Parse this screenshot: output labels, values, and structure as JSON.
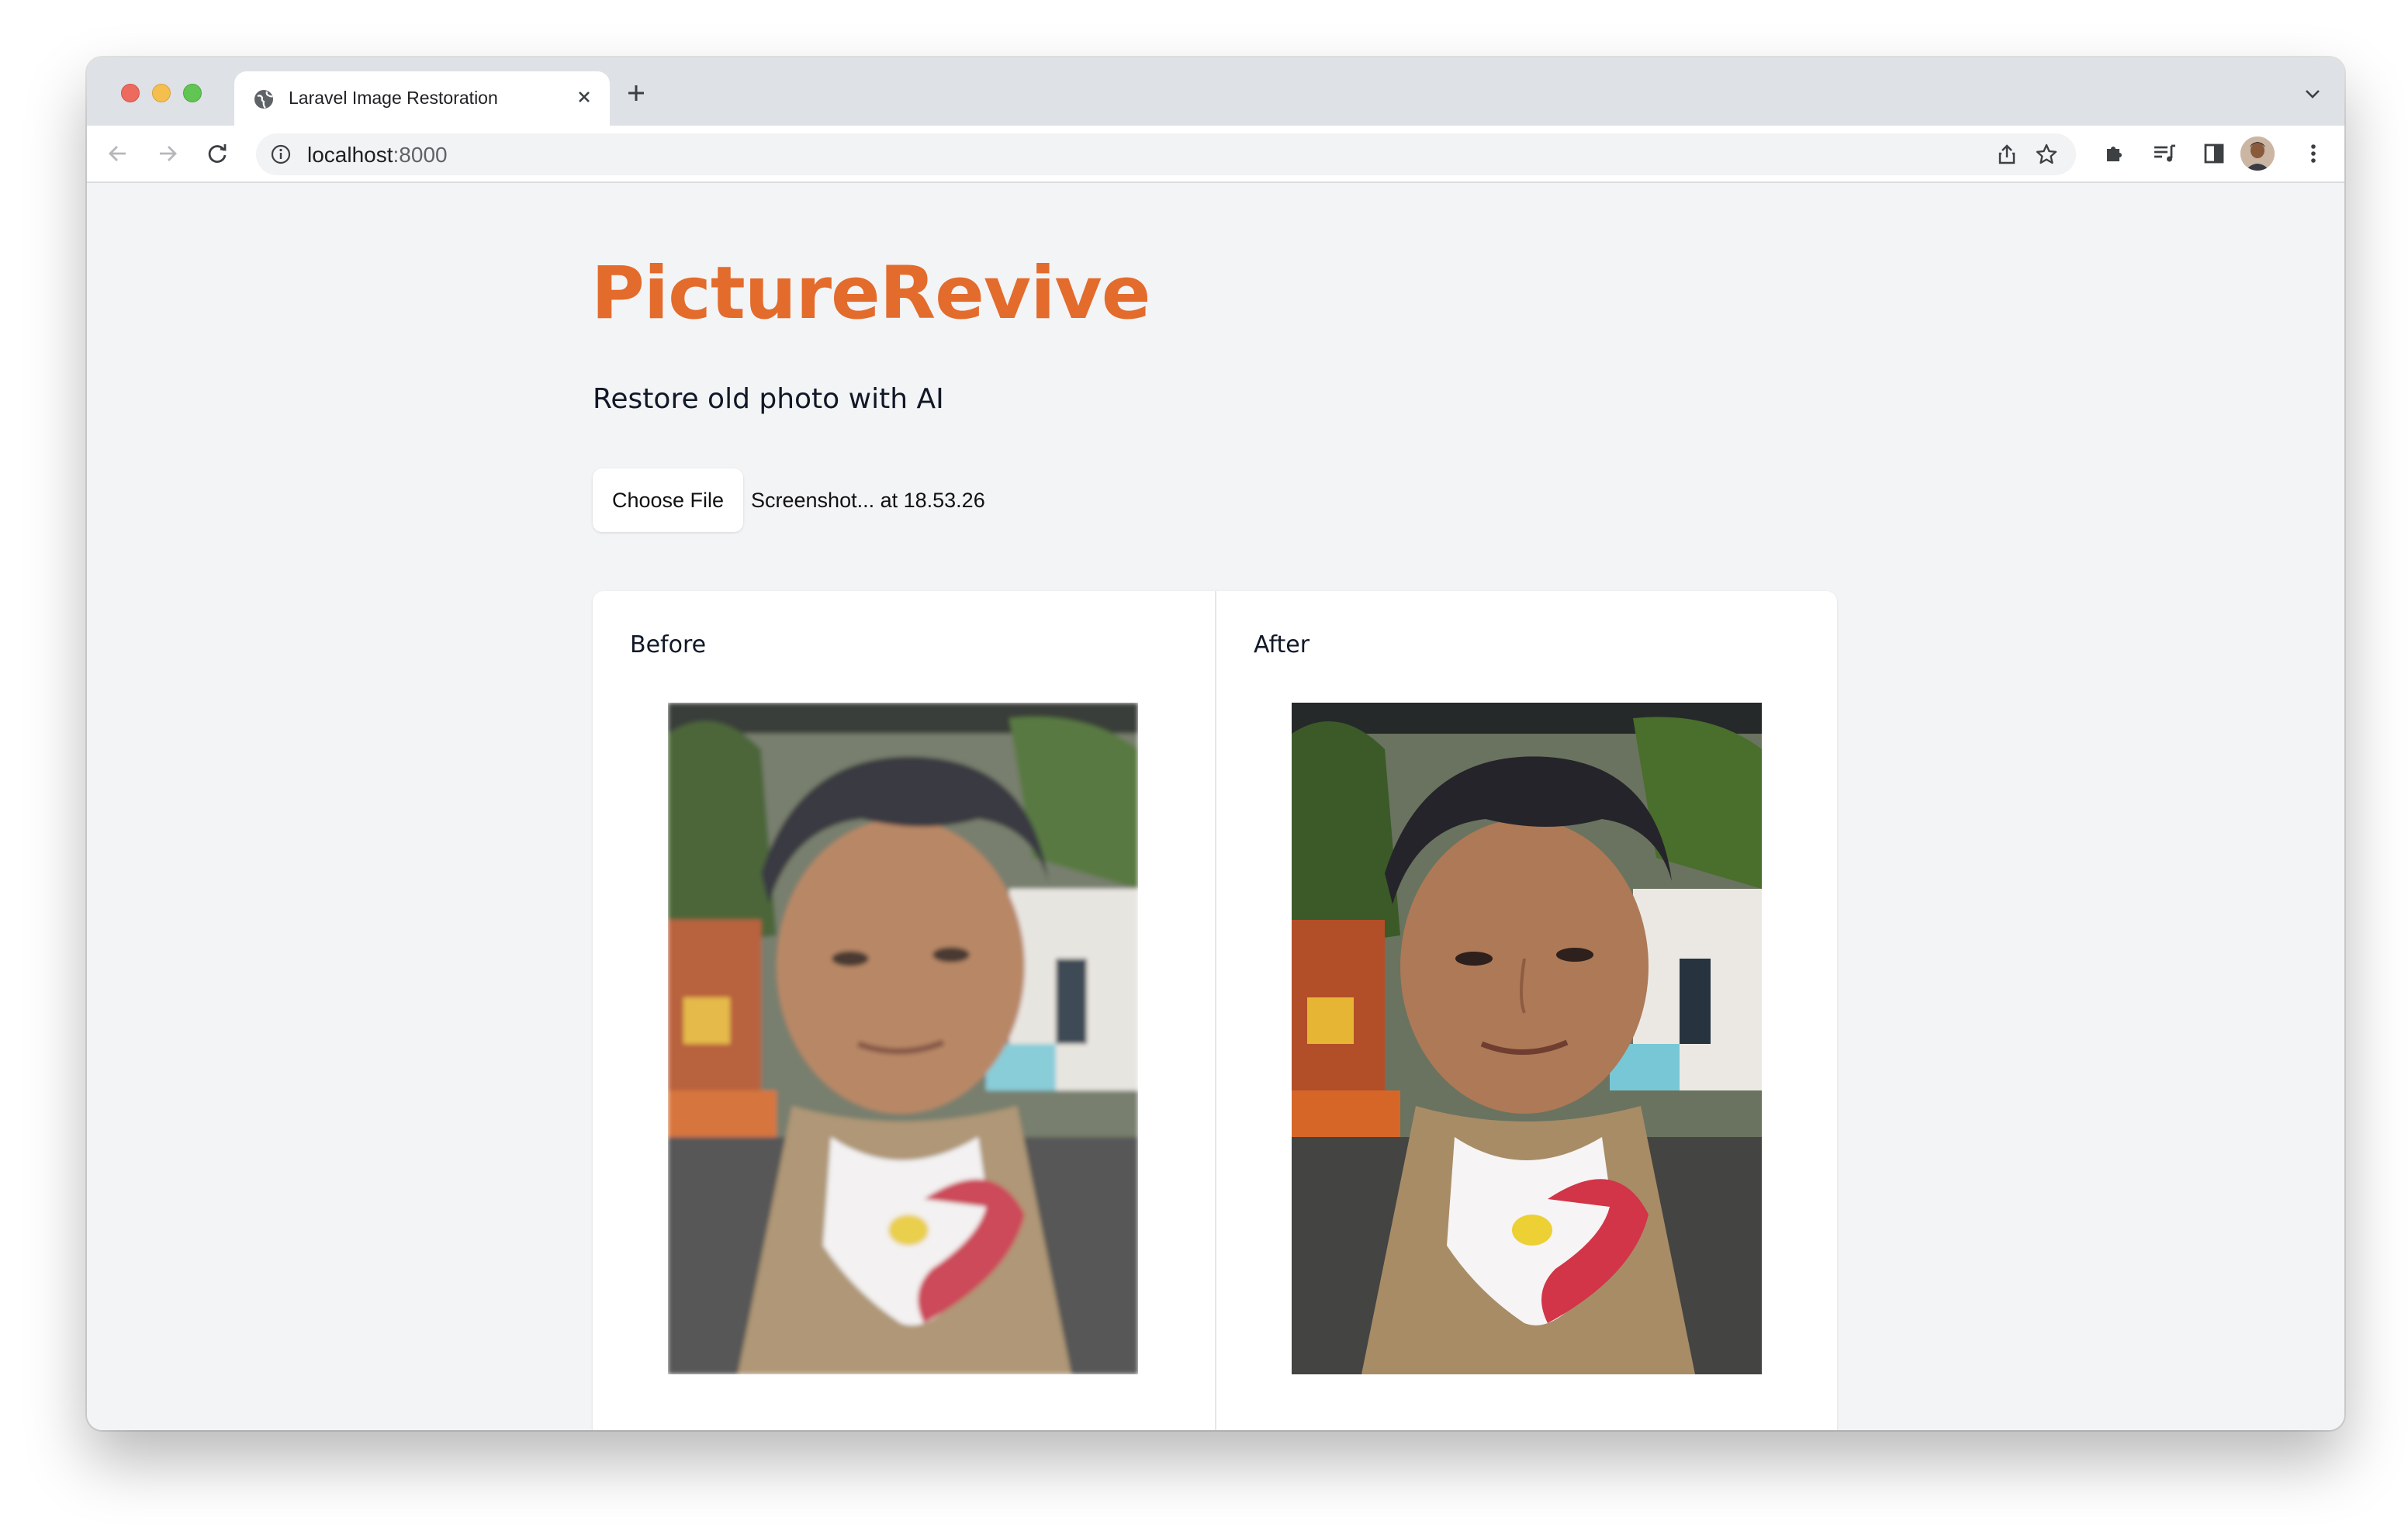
{
  "browser": {
    "tab_title": "Laravel Image Restoration",
    "url_host": "localhost",
    "url_port": ":8000",
    "icons": [
      "globe-icon",
      "close-icon",
      "plus-icon",
      "chevron-down-icon",
      "back-arrow-icon",
      "forward-arrow-icon",
      "reload-icon",
      "info-icon",
      "share-icon",
      "star-icon",
      "extensions-icon",
      "reading-list-icon",
      "side-panel-icon",
      "profile-avatar",
      "more-icon"
    ]
  },
  "page": {
    "brand": "PictureRevive",
    "tagline": "Restore old photo with AI",
    "upload": {
      "button_label": "Choose File",
      "selected_file": "Screenshot... at 18.53.26"
    },
    "comparison": {
      "before_label": "Before",
      "after_label": "After"
    }
  },
  "colors": {
    "brand": "#e36b2c",
    "page_bg": "#f3f4f6",
    "card_bg": "#ffffff"
  }
}
